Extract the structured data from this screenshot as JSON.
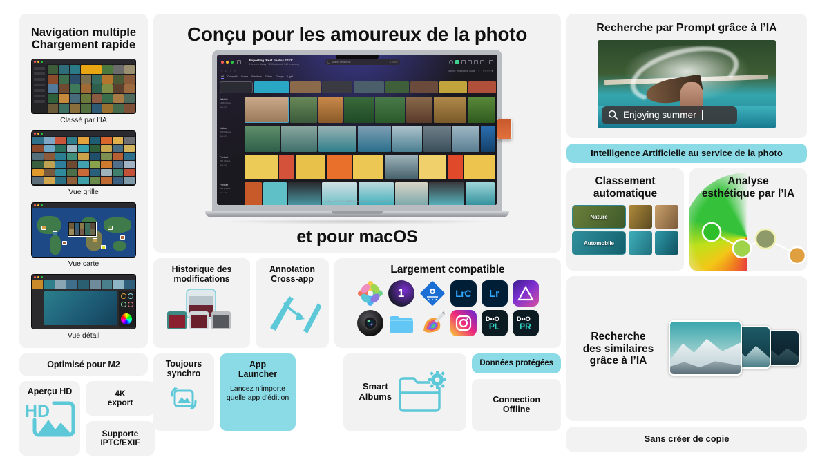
{
  "theme": {
    "page_bg": "#ffffff",
    "card_bg": "#f2f2f2",
    "accent": "#8bdbe7",
    "accent_icon": "#5cc8d8",
    "text": "#111111"
  },
  "left": {
    "nav_card": {
      "title_line1": "Navigation multiple",
      "title_line2": "Chargement rapide",
      "shots": [
        {
          "caption": "Classé par l’IA",
          "kind": "ai-sorted-library"
        },
        {
          "caption": "Vue grille",
          "kind": "grid-view"
        },
        {
          "caption": "Vue carte",
          "kind": "map-view"
        },
        {
          "caption": "Vue détail",
          "kind": "detail-view"
        }
      ]
    },
    "m2_label": "Optimisé pour M2",
    "features": {
      "hd": {
        "title": "Aperçu HD",
        "icon": "hd-image-icon"
      },
      "export4k": {
        "title_line1": "4K",
        "title_line2": "export"
      },
      "iptc": {
        "title_line1": "Supporte",
        "title_line2": "IPTC/EXIF"
      },
      "sync": {
        "title_line1": "Toujours",
        "title_line2": "synchro",
        "icon": "sync-image-icon"
      },
      "launcher": {
        "title_line1": "App",
        "title_line2": "Launcher",
        "subtitle_line1": "Lancez n’importe",
        "subtitle_line2": "quelle app d’édition"
      }
    }
  },
  "center": {
    "hero": {
      "headline": "Conçu pour les amoureux de la photo",
      "subline": "et pour macOS"
    },
    "app_window": {
      "title": "Exporting 'Best photos 2023'",
      "subtitle": "2 items in library / 1260 selected, 346 remaining",
      "search_placeholder": "Search keywords",
      "search_scope": "Library",
      "toolbar_right": "Sort by: Importance  |  Date",
      "chips": [
        "All",
        "Colorpick",
        "Scene",
        "Freeform",
        "Colors",
        "Groups",
        "Light"
      ],
      "filter_chip": "Advanced: All",
      "sections": [
        {
          "name": "Wildlife",
          "count": "1128 photos",
          "more": "See All"
        },
        {
          "name": "Nature",
          "count": "3073 photos",
          "more": "See All"
        },
        {
          "name": "Portrait",
          "count": "871 photos",
          "more": "See All"
        },
        {
          "name": "Portrait",
          "count": "642 photos",
          "more": "See All"
        }
      ],
      "status": "Sorting: 44 of 7233 PORTRAIT unselected",
      "status2": "Best photos 2023"
    },
    "history": {
      "title_line1": "Historique des",
      "title_line2": "modifications",
      "icon": "version-stack-icon"
    },
    "annotation": {
      "title_line1": "Annotation",
      "title_line2": "Cross-app",
      "icon": "pen-arrow-icon"
    },
    "compatible": {
      "title": "Largement compatible",
      "apps": [
        {
          "name": "apple-photos-icon",
          "label": ""
        },
        {
          "name": "capture-one-icon",
          "label": "1"
        },
        {
          "name": "photo-mechanic-icon",
          "label": ""
        },
        {
          "name": "lightroom-classic-icon",
          "label": "LrC"
        },
        {
          "name": "lightroom-icon",
          "label": "Lr"
        },
        {
          "name": "affinity-photo-icon",
          "label": ""
        },
        {
          "name": "camera-icon",
          "label": ""
        },
        {
          "name": "finder-folder-icon",
          "label": ""
        },
        {
          "name": "pixelmator-icon",
          "label": ""
        },
        {
          "name": "instagram-icon",
          "label": ""
        },
        {
          "name": "dxo-photolab-icon",
          "label": "PL"
        },
        {
          "name": "dxo-pureraw-icon",
          "label": "PR"
        }
      ]
    },
    "smart_albums": {
      "title_line1": "Smart",
      "title_line2": "Albums",
      "icon": "smart-folder-gear-icon"
    },
    "protected": {
      "title": "Données protégées"
    },
    "offline": {
      "title_line1": "Connection",
      "title_line2": "Offline"
    }
  },
  "right": {
    "prompt_card": {
      "title": "Recherche par Prompt grâce à l’IA",
      "search_query": "Enjoying summer",
      "search_icon": "magnifier-icon"
    },
    "banner": "Intelligence Artificielle au service de la photo",
    "classification": {
      "title_line1": "Classement",
      "title_line2": "automatique",
      "tags": [
        "Nature",
        "Automobile"
      ]
    },
    "aesthetic": {
      "title_line1": "Analyse",
      "title_line2": "esthétique par l’IA",
      "icon": "color-wheel-graph-icon"
    },
    "similar": {
      "title_line1": "Recherche",
      "title_line2": "des similaires",
      "title_line3": "grâce à l’IA"
    },
    "no_copy": "Sans créer de copie"
  }
}
